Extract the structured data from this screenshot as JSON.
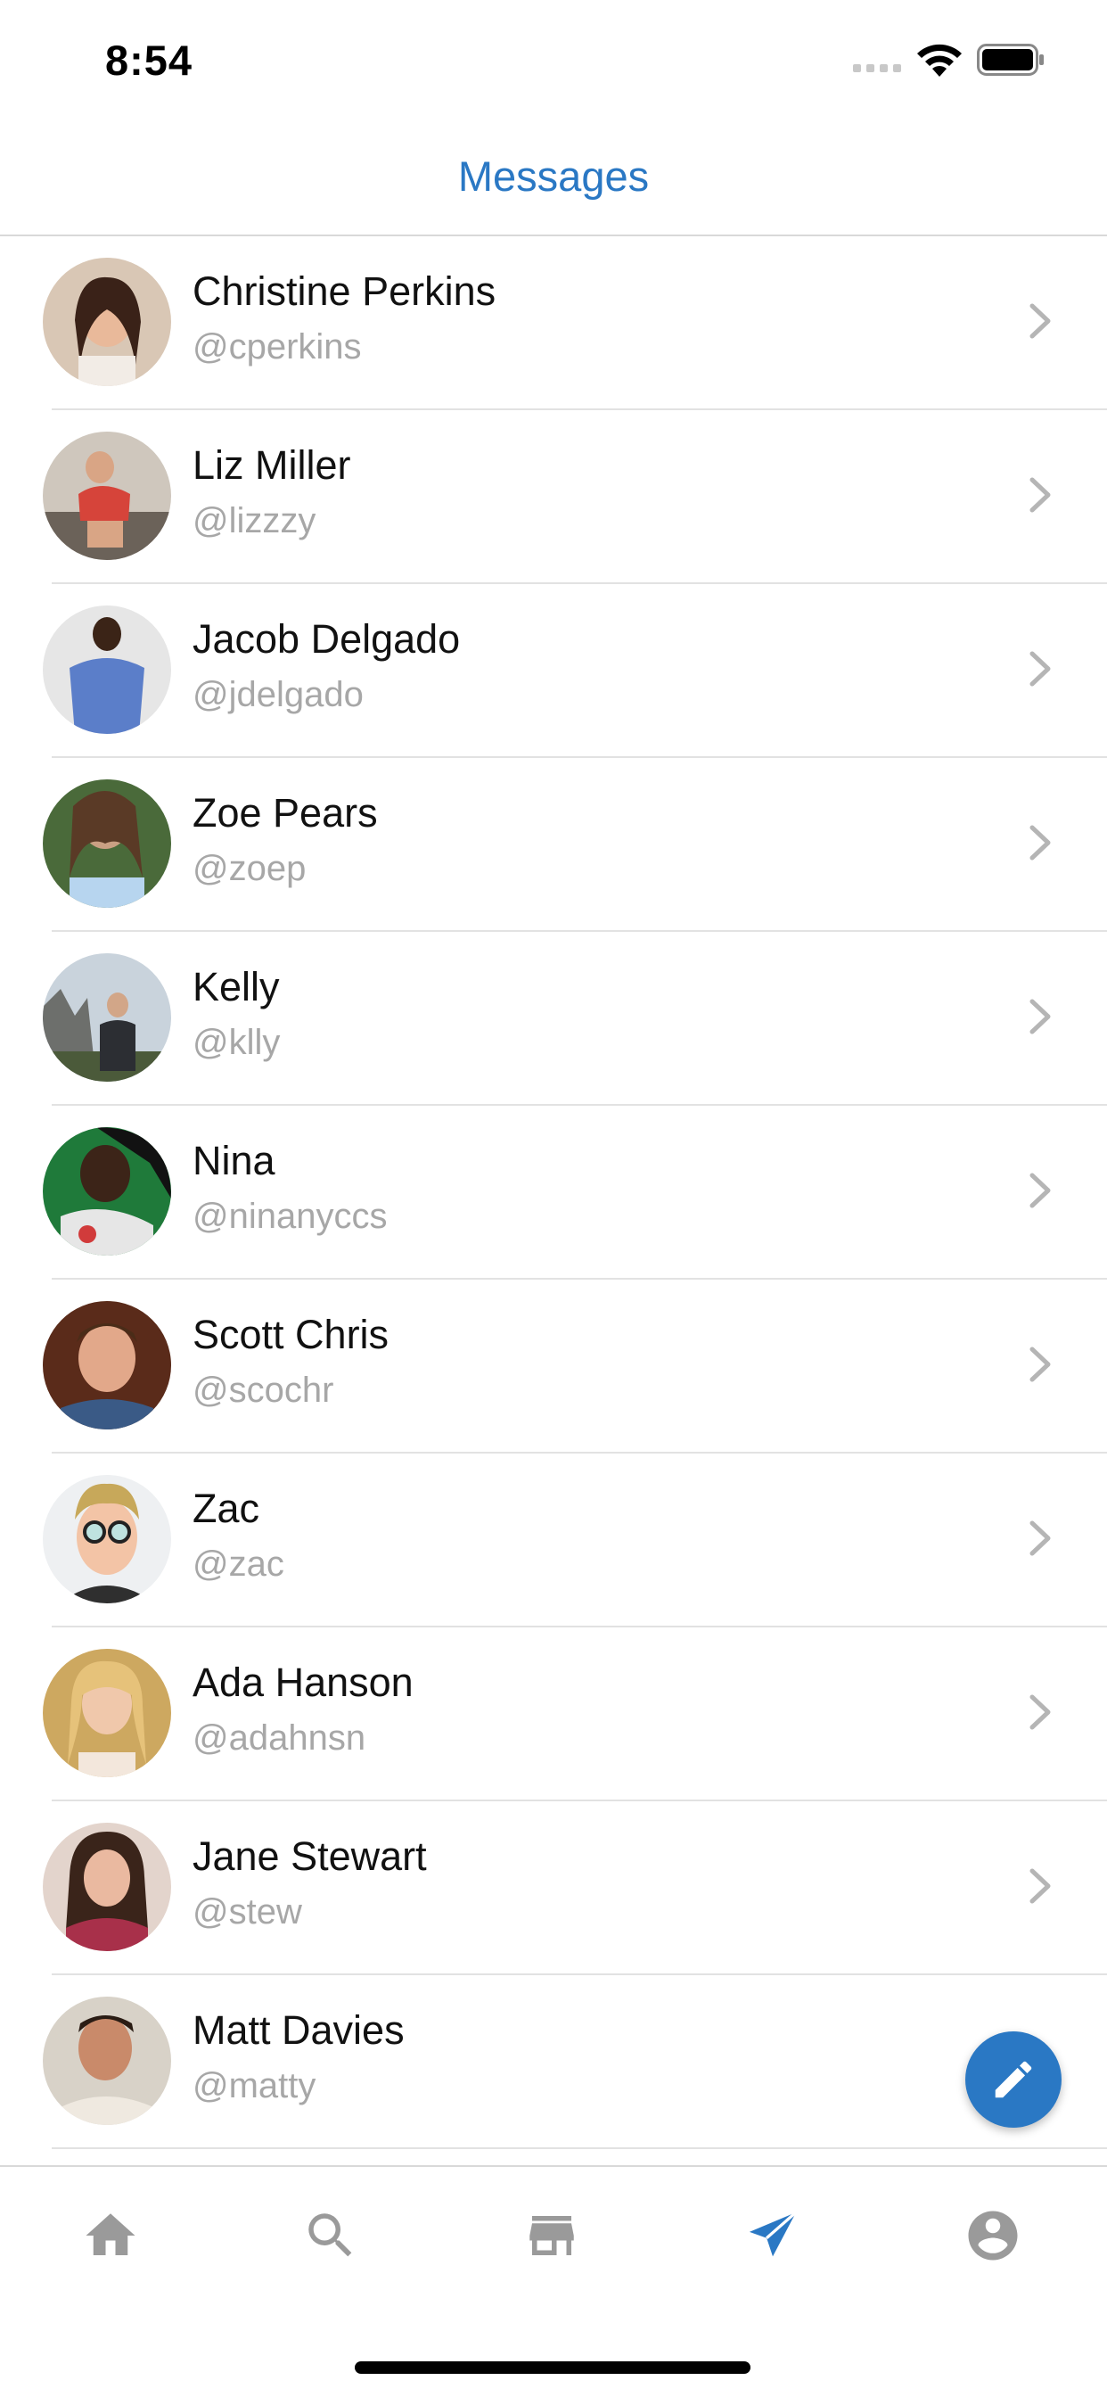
{
  "status_bar": {
    "time": "8:54"
  },
  "header": {
    "title": "Messages"
  },
  "contacts": [
    {
      "name": "Christine Perkins",
      "handle": "@cperkins"
    },
    {
      "name": "Liz Miller",
      "handle": "@lizzzy"
    },
    {
      "name": "Jacob Delgado",
      "handle": "@jdelgado"
    },
    {
      "name": "Zoe Pears",
      "handle": "@zoep"
    },
    {
      "name": "Kelly",
      "handle": "@klly"
    },
    {
      "name": "Nina",
      "handle": "@ninanyccs"
    },
    {
      "name": "Scott Chris",
      "handle": "@scochr"
    },
    {
      "name": "Zac",
      "handle": "@zac"
    },
    {
      "name": "Ada Hanson",
      "handle": "@adahnsn"
    },
    {
      "name": "Jane Stewart",
      "handle": "@stew"
    },
    {
      "name": "Matt Davies",
      "handle": "@matty"
    }
  ],
  "tab_bar": {
    "items": [
      {
        "icon": "home-icon"
      },
      {
        "icon": "search-icon"
      },
      {
        "icon": "store-icon"
      },
      {
        "icon": "send-icon",
        "active": true
      },
      {
        "icon": "account-icon"
      }
    ]
  },
  "colors": {
    "accent": "#2a78c4",
    "inactive": "#9a9a9a",
    "handle": "#a7a7a7",
    "divider": "#e2e2e2"
  }
}
